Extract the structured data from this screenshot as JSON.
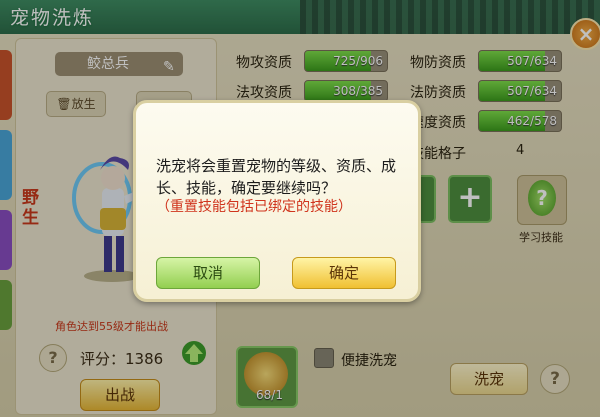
{
  "window": {
    "title": "宠物洗炼",
    "close_icon": "close-icon"
  },
  "pet": {
    "name": "鲛总兵",
    "release_label": "放生",
    "wild_label": "野生",
    "hint": "角色达到55级才能出战",
    "score_label": "评分：",
    "score": "1386",
    "fight_label": "出战"
  },
  "stats": [
    {
      "label": "物攻资质",
      "value": "725/906",
      "fraction": 0.8
    },
    {
      "label": "物防资质",
      "value": "507/634",
      "fraction": 0.8
    },
    {
      "label": "法攻资质",
      "value": "308/385",
      "fraction": 0.8
    },
    {
      "label": "法防资质",
      "value": "507/634",
      "fraction": 0.8
    },
    {
      "label": "速度资质",
      "value": "462/578",
      "fraction": 0.8
    }
  ],
  "skills": {
    "slots_label": "技能格子",
    "slots_value": "4",
    "learn_label": "学习技能"
  },
  "bottom": {
    "item_count": "68/1",
    "quick_label": "便捷洗宠",
    "wash_label": "洗宠"
  },
  "dialog": {
    "message": "洗宠将会重置宠物的等级、资质、成长、技能，确定要继续吗？",
    "warning": "（重置技能包括已绑定的技能）",
    "cancel_label": "取消",
    "confirm_label": "确定"
  },
  "colors": {
    "accent": "#3c9c1d",
    "warning": "#d0341d",
    "title_bar": "#2d6d4a"
  }
}
